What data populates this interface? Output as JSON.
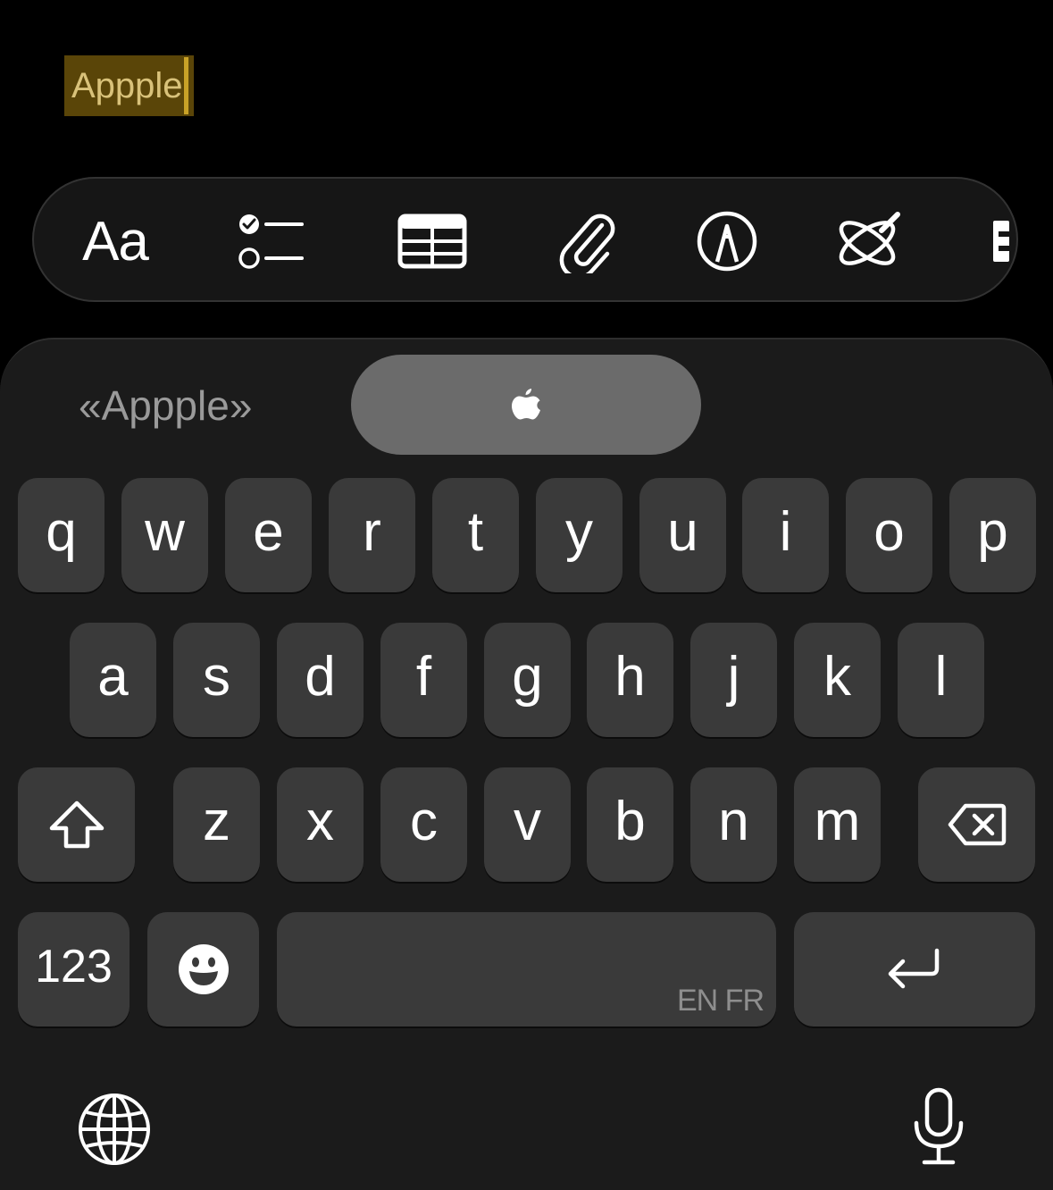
{
  "editor": {
    "typed_text": "Appple"
  },
  "toolbar": {
    "format_label": "Aa",
    "items": [
      "format-button",
      "checklist-icon",
      "table-icon",
      "attachment-icon",
      "markup-icon",
      "writing-tools-icon",
      "more-icon"
    ]
  },
  "keyboard": {
    "suggestion": "«Appple»",
    "row1": [
      "q",
      "w",
      "e",
      "r",
      "t",
      "y",
      "u",
      "i",
      "o",
      "p"
    ],
    "row2": [
      "a",
      "s",
      "d",
      "f",
      "g",
      "h",
      "j",
      "k",
      "l"
    ],
    "row3": [
      "z",
      "x",
      "c",
      "v",
      "b",
      "n",
      "m"
    ],
    "numbers_label": "123",
    "space_language": "EN FR"
  },
  "colors": {
    "background": "#000000",
    "key": "#3a3a3a",
    "highlight": "#5a4508",
    "caret": "#c9a227"
  }
}
